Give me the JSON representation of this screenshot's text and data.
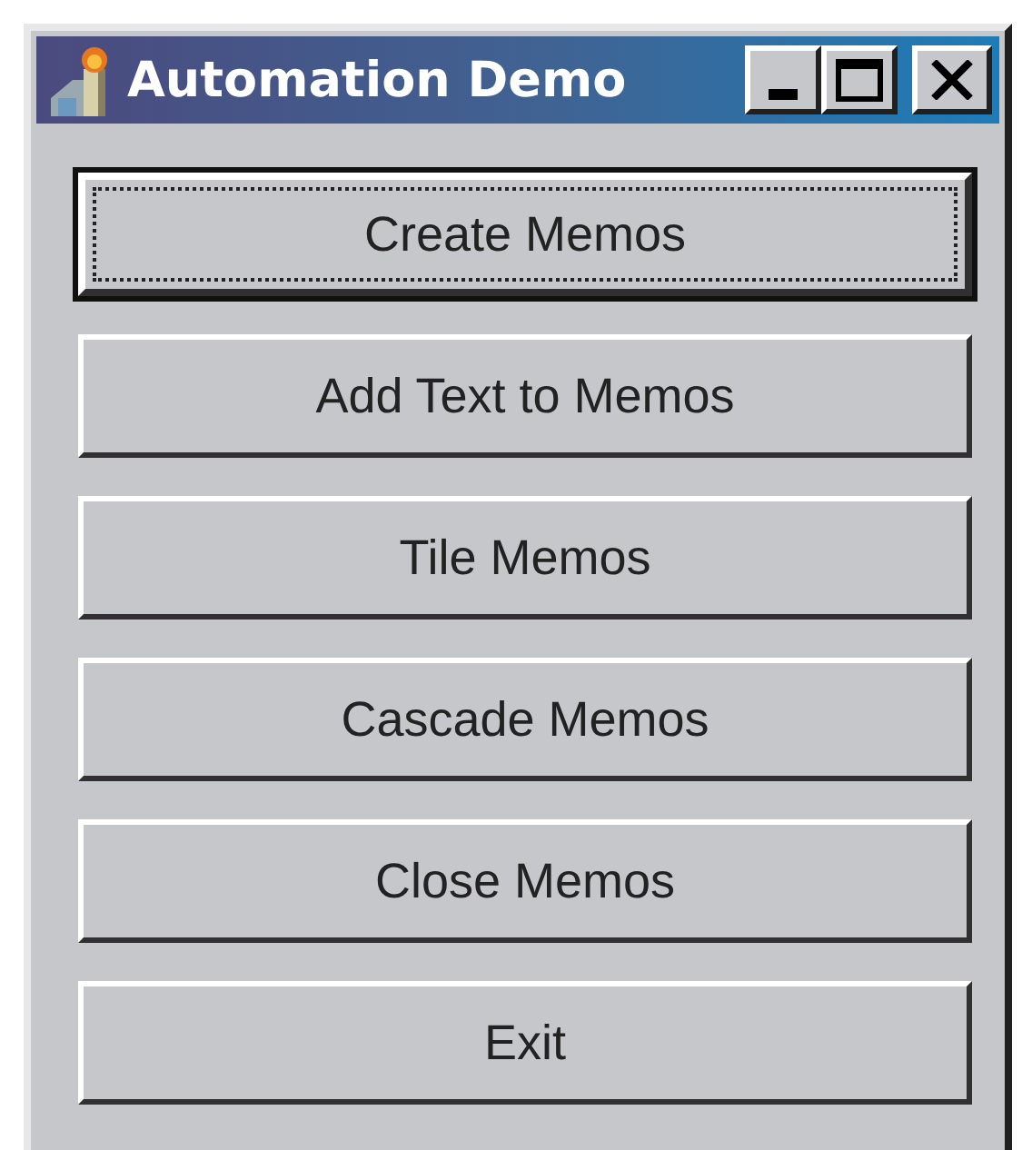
{
  "window": {
    "title": "Automation Demo",
    "caption_buttons": [
      {
        "kind": "minimize"
      },
      {
        "kind": "maximize"
      },
      {
        "kind": "close"
      }
    ]
  },
  "buttons": [
    {
      "label": "Create Memos",
      "focused": true
    },
    {
      "label": "Add Text to Memos",
      "focused": false
    },
    {
      "label": "Tile Memos",
      "focused": false
    },
    {
      "label": "Cascade Memos",
      "focused": false
    },
    {
      "label": "Close Memos",
      "focused": false
    },
    {
      "label": "Exit",
      "focused": false
    }
  ]
}
